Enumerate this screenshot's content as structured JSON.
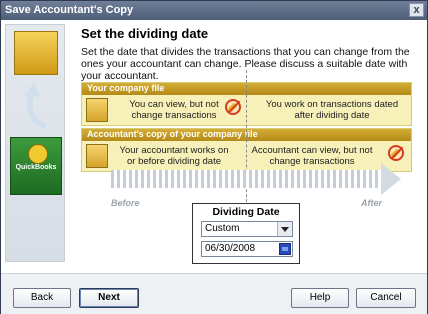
{
  "window": {
    "title": "Save Accountant's Copy",
    "close_label": "x"
  },
  "sidebar": {
    "logo_text": "QuickBooks"
  },
  "heading": "Set the dividing date",
  "description": "Set the date that divides the transactions that you can change from the ones your accountant can change. Please discuss a suitable date with your accountant.",
  "panels": {
    "company": {
      "header": "Your company file",
      "left_text": "You can view, but not change transactions",
      "right_text": "You work on transactions dated after dividing date"
    },
    "accountant": {
      "header": "Accountant's copy of your company file",
      "left_text": "Your accountant works on or before dividing date",
      "right_text": "Accountant can view, but not change transactions"
    }
  },
  "timeline": {
    "before": "Before",
    "after": "After"
  },
  "dividing_date": {
    "title": "Dividing Date",
    "select_value": "Custom",
    "date_value": "06/30/2008"
  },
  "buttons": {
    "back": "Back",
    "next": "Next",
    "help": "Help",
    "cancel": "Cancel"
  }
}
